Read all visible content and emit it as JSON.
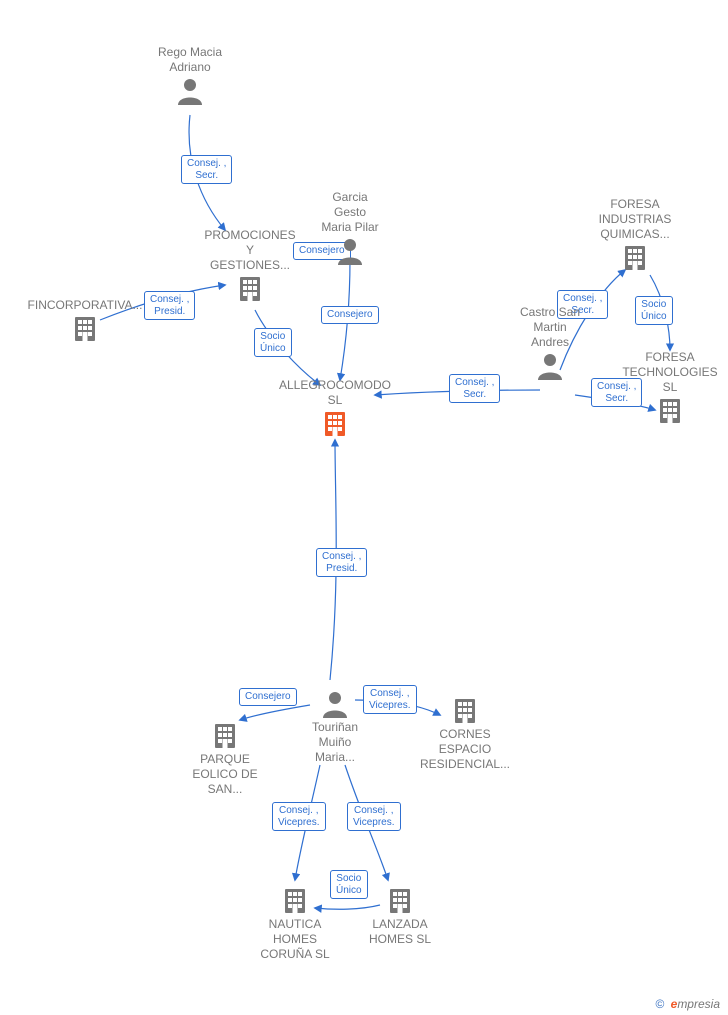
{
  "nodes": {
    "rego": {
      "label": "Rego Macia\nAdriano",
      "type": "person"
    },
    "garcia": {
      "label": "Garcia\nGesto\nMaria Pilar",
      "type": "person"
    },
    "castro": {
      "label": "Castro San\nMartin\nAndres",
      "type": "person"
    },
    "tourinan": {
      "label": "Touriñan\nMuiño\nMaria...",
      "type": "person"
    },
    "fincorp": {
      "label": "FINCORPORATIVA...",
      "type": "company"
    },
    "promo": {
      "label": "PROMOCIONES\nY\nGESTIONES...",
      "type": "company"
    },
    "foresa_ind": {
      "label": "FORESA\nINDUSTRIAS\nQUIMICAS...",
      "type": "company"
    },
    "foresa_tech": {
      "label": "FORESA\nTECHNOLOGIES\nSL",
      "type": "company"
    },
    "allegro": {
      "label": "ALLEGROCOMODO\n SL",
      "type": "company-focus"
    },
    "parque": {
      "label": "PARQUE\nEOLICO DE\nSAN...",
      "type": "company"
    },
    "cornes": {
      "label": "CORNES\nESPACIO\nRESIDENCIAL...",
      "type": "company"
    },
    "nautica": {
      "label": "NAUTICA\nHOMES\nCORUÑA  SL",
      "type": "company"
    },
    "lanzada": {
      "label": "LANZADA\nHOMES  SL",
      "type": "company"
    }
  },
  "edges": {
    "rego_promo": {
      "label": "Consej. ,\nSecr."
    },
    "garcia_promo": {
      "label": "Consejero"
    },
    "garcia_allegro": {
      "label": "Consejero"
    },
    "fincorp_promo": {
      "label": "Consej. ,\nPresid."
    },
    "promo_allegro": {
      "label": "Socio\nÚnico"
    },
    "castro_allegro": {
      "label": "Consej. ,\nSecr."
    },
    "castro_foresa_ind": {
      "label": "Consej. ,\nSecr."
    },
    "castro_foresa_tech": {
      "label": "Consej. ,\nSecr."
    },
    "foresa_ind_tech": {
      "label": "Socio\nÚnico"
    },
    "tourinan_allegro": {
      "label": "Consej. ,\nPresid."
    },
    "tourinan_parque": {
      "label": "Consejero"
    },
    "tourinan_cornes": {
      "label": "Consej. ,\nVicepres."
    },
    "tourinan_nautica": {
      "label": "Consej. ,\nVicepres."
    },
    "tourinan_lanzada": {
      "label": "Consej. ,\nVicepres."
    },
    "lanzada_nautica": {
      "label": "Socio\nÚnico"
    }
  },
  "footer": {
    "copy": "©",
    "brand_e": "e",
    "brand_rest": "mpresia"
  }
}
